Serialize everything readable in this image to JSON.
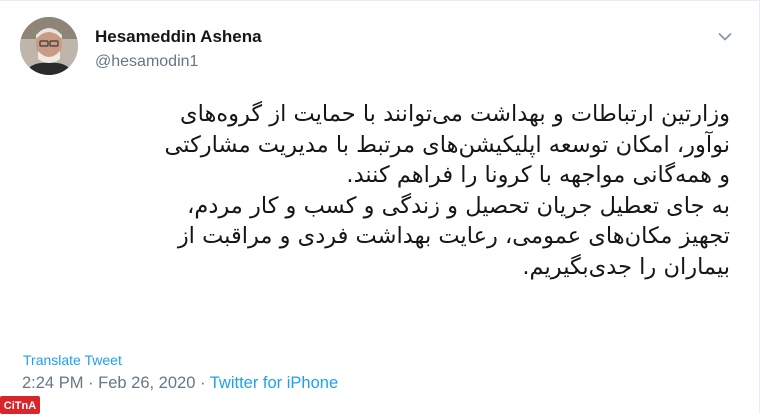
{
  "author": {
    "name": "Hesameddin Ashena",
    "handle": "@hesamodin1"
  },
  "tweet": {
    "lines": [
      "وزارتین ارتباطات و بهداشت می‌توانند با حمایت از گروه‌های",
      "نوآور، امکان توسعه اپلیکیشن‌های مرتبط با مدیریت مشارکتی",
      "و همه‌گانی مواجهه با کرونا را فراهم کنند.",
      "به جای تعطیل جریان تحصیل و زندگی و کسب و کار مردم،",
      "تجهیز مکان‌های عمومی، رعایت بهداشت فردی و مراقبت از",
      "بیماران را جدی‌بگیریم."
    ]
  },
  "translate_label": "Translate Tweet",
  "meta": {
    "time": "2:24 PM",
    "separator1": " · ",
    "date": "Feb 26, 2020",
    "separator2": " · ",
    "source": "Twitter for iPhone"
  },
  "icons": {
    "menu": "chevron-down-icon",
    "avatar": "avatar"
  },
  "watermark": {
    "text": "CiTnA",
    "color": "#d9262c"
  },
  "colors": {
    "link": "#1da1f2",
    "muted": "#657786",
    "text": "#14171a"
  }
}
